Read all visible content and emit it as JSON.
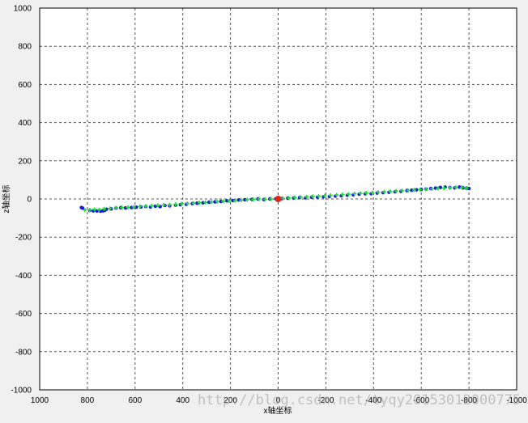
{
  "chart_data": {
    "type": "scatter",
    "title": "",
    "xlabel": "x轴坐标",
    "ylabel": "z轴坐标",
    "xlim": [
      1000,
      -1000
    ],
    "ylim": [
      -1000,
      1000
    ],
    "x_reversed": true,
    "grid": true,
    "grid_style": "dashed",
    "xticks": [
      1000,
      800,
      600,
      400,
      200,
      0,
      -200,
      -400,
      -600,
      -800,
      -1000
    ],
    "xtick_labels": [
      "1000",
      "800",
      "600",
      "400",
      "200",
      "0",
      "-200",
      "-400",
      "-600",
      "-800",
      "-1000"
    ],
    "yticks": [
      1000,
      800,
      600,
      400,
      200,
      0,
      -200,
      -400,
      -600,
      -800,
      -1000
    ],
    "ytick_labels": [
      "1000",
      "800",
      "600",
      "400",
      "200",
      "0",
      "-200",
      "-400",
      "-600",
      "-800",
      "-1000"
    ],
    "series": [
      {
        "color": "#1515e6",
        "marker": "dot",
        "points": [
          [
            825,
            -45
          ],
          [
            820,
            -48
          ],
          [
            790,
            -60
          ],
          [
            775,
            -62
          ],
          [
            760,
            -63
          ],
          [
            745,
            -64
          ],
          [
            735,
            -62
          ],
          [
            728,
            -60
          ],
          [
            720,
            -54
          ],
          [
            700,
            -52
          ],
          [
            680,
            -48
          ],
          [
            660,
            -46
          ],
          [
            640,
            -47
          ],
          [
            615,
            -45
          ],
          [
            595,
            -43
          ],
          [
            575,
            -42
          ],
          [
            555,
            -40
          ],
          [
            535,
            -42
          ],
          [
            515,
            -38
          ],
          [
            495,
            -40
          ],
          [
            475,
            -34
          ],
          [
            455,
            -36
          ],
          [
            430,
            -32
          ],
          [
            410,
            -30
          ],
          [
            385,
            -28
          ],
          [
            360,
            -24
          ],
          [
            340,
            -22
          ],
          [
            315,
            -20
          ],
          [
            290,
            -17
          ],
          [
            265,
            -15
          ],
          [
            240,
            -13
          ],
          [
            215,
            -10
          ],
          [
            190,
            -8
          ],
          [
            165,
            -5
          ],
          [
            140,
            -4
          ],
          [
            110,
            -2
          ],
          [
            85,
            0
          ],
          [
            60,
            -3
          ],
          [
            35,
            0
          ],
          [
            10,
            1
          ],
          [
            -15,
            2
          ],
          [
            -40,
            4
          ],
          [
            -65,
            5
          ],
          [
            -90,
            7
          ],
          [
            -115,
            6
          ],
          [
            -140,
            9
          ],
          [
            -165,
            10
          ],
          [
            -190,
            12
          ],
          [
            -215,
            13
          ],
          [
            -240,
            15
          ],
          [
            -265,
            17
          ],
          [
            -290,
            20
          ],
          [
            -315,
            22
          ],
          [
            -340,
            25
          ],
          [
            -365,
            27
          ],
          [
            -390,
            28
          ],
          [
            -415,
            31
          ],
          [
            -440,
            33
          ],
          [
            -465,
            35
          ],
          [
            -490,
            38
          ],
          [
            -515,
            40
          ],
          [
            -540,
            44
          ],
          [
            -560,
            46
          ],
          [
            -580,
            48
          ],
          [
            -600,
            50
          ],
          [
            -620,
            52
          ],
          [
            -640,
            55
          ],
          [
            -660,
            57
          ],
          [
            -680,
            60
          ],
          [
            -700,
            62
          ],
          [
            -720,
            60
          ],
          [
            -740,
            58
          ],
          [
            -760,
            62
          ],
          [
            -775,
            58
          ],
          [
            -790,
            56
          ],
          [
            -800,
            55
          ]
        ]
      },
      {
        "color": "#22d83a",
        "marker": "plus",
        "points": [
          [
            810,
            -58
          ],
          [
            790,
            -57
          ],
          [
            770,
            -55
          ],
          [
            750,
            -56
          ],
          [
            730,
            -52
          ],
          [
            705,
            -50
          ],
          [
            680,
            -47
          ],
          [
            655,
            -45
          ],
          [
            630,
            -44
          ],
          [
            605,
            -42
          ],
          [
            580,
            -40
          ],
          [
            555,
            -38
          ],
          [
            530,
            -36
          ],
          [
            505,
            -34
          ],
          [
            480,
            -32
          ],
          [
            455,
            -30
          ],
          [
            430,
            -28
          ],
          [
            405,
            -26
          ],
          [
            380,
            -24
          ],
          [
            355,
            -22
          ],
          [
            330,
            -20
          ],
          [
            305,
            -18
          ],
          [
            280,
            -16
          ],
          [
            255,
            -14
          ],
          [
            230,
            -12
          ],
          [
            205,
            -10
          ],
          [
            180,
            -8
          ],
          [
            155,
            -6
          ],
          [
            130,
            -4
          ],
          [
            105,
            -2
          ],
          [
            80,
            0
          ],
          [
            55,
            -2
          ],
          [
            30,
            0
          ],
          [
            5,
            1
          ],
          [
            -20,
            3
          ],
          [
            -45,
            5
          ],
          [
            -70,
            7
          ],
          [
            -95,
            9
          ],
          [
            -120,
            11
          ],
          [
            -145,
            13
          ],
          [
            -170,
            15
          ],
          [
            -195,
            17
          ],
          [
            -220,
            19
          ],
          [
            -245,
            21
          ],
          [
            -270,
            23
          ],
          [
            -295,
            25
          ],
          [
            -320,
            27
          ],
          [
            -345,
            29
          ],
          [
            -370,
            31
          ],
          [
            -395,
            33
          ],
          [
            -420,
            35
          ],
          [
            -445,
            37
          ],
          [
            -470,
            39
          ],
          [
            -495,
            41
          ],
          [
            -520,
            43
          ],
          [
            -545,
            45
          ],
          [
            -570,
            47
          ],
          [
            -595,
            49
          ],
          [
            -620,
            51
          ],
          [
            -645,
            53
          ],
          [
            -670,
            55
          ],
          [
            -695,
            57
          ],
          [
            -720,
            59
          ],
          [
            -745,
            61
          ],
          [
            -770,
            60
          ],
          [
            -790,
            57
          ]
        ]
      },
      {
        "color": "#e0241b",
        "marker": "large-dot",
        "points": [
          [
            0,
            0
          ]
        ]
      }
    ],
    "watermark": "http://blog.csdn.net/tyqy20153012000775"
  }
}
